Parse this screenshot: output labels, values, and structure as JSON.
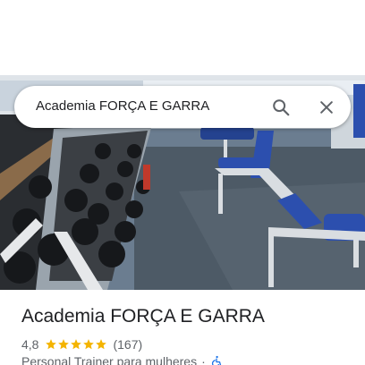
{
  "search": {
    "query": "Academia FORÇA E GARRA",
    "search_icon": "search-icon",
    "close_icon": "close-icon"
  },
  "photo": {
    "subject": "gym-interior-photo"
  },
  "place": {
    "title": "Academia FORÇA E GARRA",
    "rating": "4,8",
    "stars": 5,
    "reviews": "(167)",
    "category": "Personal Trainer para mulheres",
    "separator": "·",
    "accessibility_icon": "wheelchair-icon"
  },
  "colors": {
    "star": "#f4b400",
    "text_primary": "#202124",
    "text_secondary": "#5f6368",
    "accessible": "#1a73e8"
  }
}
